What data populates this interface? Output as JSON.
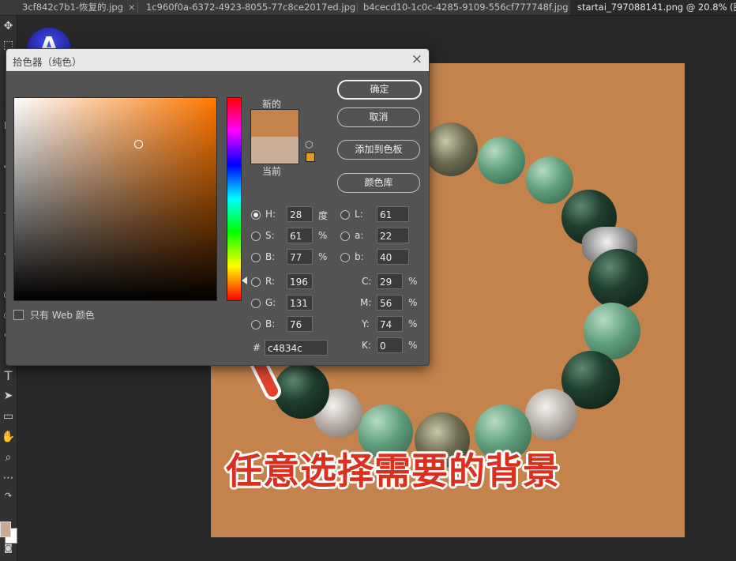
{
  "tabs": [
    {
      "label": "3cf842c7b1-恢复的.jpg",
      "close": "×"
    },
    {
      "label": "1c960f0a-6372-4923-8055-77c8ce2017ed.jpg",
      "close": "×"
    },
    {
      "label": "b4cecd10-1c0c-4285-9109-556cf777748f.jpg",
      "close": "×"
    },
    {
      "label": "startai_797088141.png @ 20.8% (图层",
      "close": ""
    }
  ],
  "toolbar": {
    "icons": [
      "move-icon",
      "brush-icon",
      "crop-icon",
      "frame-icon",
      "eyedropper-icon",
      "healing-icon",
      "stamp-icon",
      "eraser-icon",
      "gradient-icon",
      "blur-icon",
      "dodge-icon",
      "pen-icon",
      "type-icon",
      "path-select-icon",
      "rectangle-icon",
      "hand-icon",
      "zoom-icon",
      "more-icon"
    ],
    "type_glyph": "T"
  },
  "avatar": {
    "letter": "A"
  },
  "dialog": {
    "title": "拾色器（纯色）",
    "close_glyph": "×",
    "new_label": "新的",
    "current_label": "当前",
    "web_only_label": "只有 Web 颜色",
    "buttons": {
      "ok": "确定",
      "cancel": "取消",
      "add_to_swatches": "添加到色板",
      "libraries": "颜色库"
    },
    "hsb": {
      "h": {
        "label": "H:",
        "value": "28",
        "unit": "度"
      },
      "s": {
        "label": "S:",
        "value": "61",
        "unit": "%"
      },
      "b": {
        "label": "B:",
        "value": "77",
        "unit": "%"
      }
    },
    "lab": {
      "l": {
        "label": "L:",
        "value": "61"
      },
      "a": {
        "label": "a:",
        "value": "22"
      },
      "b": {
        "label": "b:",
        "value": "40"
      }
    },
    "rgb": {
      "r": {
        "label": "R:",
        "value": "196"
      },
      "g": {
        "label": "G:",
        "value": "131"
      },
      "b": {
        "label": "B:",
        "value": "76"
      }
    },
    "cmyk": {
      "c": {
        "label": "C:",
        "value": "29",
        "unit": "%"
      },
      "m": {
        "label": "M:",
        "value": "56",
        "unit": "%"
      },
      "y": {
        "label": "Y:",
        "value": "74",
        "unit": "%"
      },
      "k": {
        "label": "K:",
        "value": "0",
        "unit": "%"
      }
    },
    "hex": {
      "prefix": "#",
      "value": "c4834c"
    },
    "colors": {
      "new": "#c4834c",
      "current": "#c9ae98",
      "gamut_warning": "#e09b22"
    }
  },
  "canvas": {
    "background": "#c4834c"
  },
  "caption": {
    "text": "任意选择需要的背景",
    "color": "#d93020"
  }
}
